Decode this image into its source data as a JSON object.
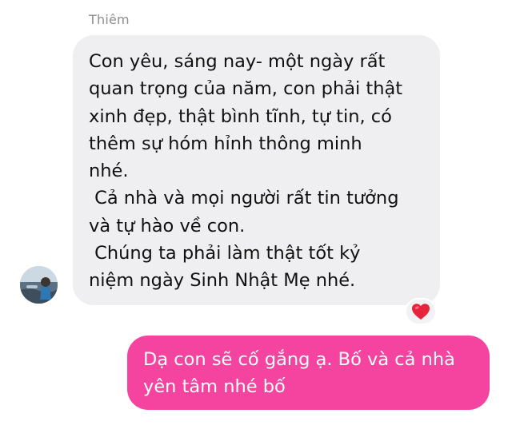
{
  "conversation": {
    "incoming": {
      "sender_name": "Thiêm",
      "text": "Con yêu, sáng nay- một ngày rất\nquan trọng của năm, con phải thật\nxinh đẹp, thật bình tĩnh, tự tin, có\nthêm sự hóm hỉnh thông minh\nnhé.\n Cả nhà và mọi người rất tin tưởng\nvà tự hào về con.\n Chúng ta phải làm thật tốt kỷ\nniệm ngày Sinh Nhật Mẹ nhé.",
      "reaction_icon": "heart-icon"
    },
    "outgoing": {
      "text": "Dạ con sẽ cố gắng ạ. Bố và cả nhà\nyên tâm nhé bố"
    }
  },
  "colors": {
    "incoming_bubble": "#efeff1",
    "outgoing_bubble": "#f4449f",
    "reaction_heart": "#e8243d",
    "sender_name": "#8e8e93"
  }
}
